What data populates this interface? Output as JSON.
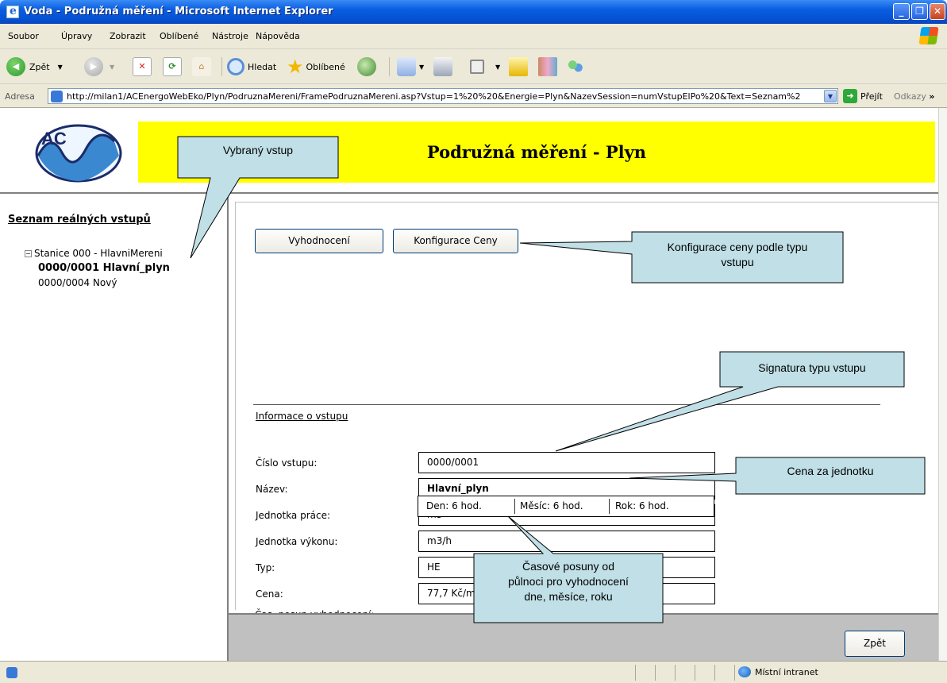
{
  "window": {
    "title": "Voda - Podružná měření - Microsoft Internet Explorer",
    "buttons": [
      "minimize-icon",
      "maximize-icon",
      "close-icon"
    ]
  },
  "menu": [
    "Soubor",
    "Úpravy",
    "Zobrazit",
    "Oblíbené",
    "Nástroje",
    "Nápověda"
  ],
  "toolbar": {
    "back": "Zpět",
    "search": "Hledat",
    "favorites": "Oblíbené"
  },
  "address": {
    "label": "Adresa",
    "url": "http://milan1/ACEnergoWebEko/Plyn/PodruznaMereni/FramePodruznaMereni.asp?Vstup=1%20%20&Energie=Plyn&NazevSession=numVstupElPo%20&Text=Seznam%2",
    "go": "Přejít",
    "links": "Odkazy"
  },
  "header": {
    "title": "Podružná měření - Plyn",
    "logo_text": "AC"
  },
  "sidebar": {
    "heading": "Seznam reálných vstupů",
    "station": "Stanice 000 - HlavniMereni",
    "items": [
      {
        "label": "0000/0001 Hlavní_plyn",
        "selected": true
      },
      {
        "label": "0000/0004 Nový",
        "selected": false
      }
    ]
  },
  "main": {
    "buttons": {
      "evaluation": "Vyhodnocení",
      "price_config": "Konfigurace Ceny"
    },
    "section_title": "Informace o vstupu",
    "fields": [
      {
        "label": "Číslo vstupu:",
        "value": "0000/0001"
      },
      {
        "label": "Název:",
        "value": "Hlavní_plyn"
      },
      {
        "label": "Jednotka práce:",
        "value": "m3"
      },
      {
        "label": "Jednotka výkonu:",
        "value": "m3/h"
      },
      {
        "label": "Typ:",
        "value": "HE"
      },
      {
        "label": "Cena:",
        "value": "77,7 Kč/m3"
      }
    ],
    "offset": {
      "label": "Čas. posun vyhodnocení:",
      "day": "Den: 6 hod.",
      "month": "Měsíc: 6 hod.",
      "year": "Rok: 6 hod."
    }
  },
  "footer": {
    "back": "Zpět"
  },
  "status": {
    "zone": "Místní intranet"
  },
  "callouts": {
    "selected_input": "Vybraný vstup",
    "price_config": [
      "Konfigurace ceny podle typu",
      "vstupu"
    ],
    "type_signature": "Signatura typu vstupu",
    "unit_price": "Cena za jednotku",
    "time_offsets": [
      "Časové posuny od",
      "půlnoci pro vyhodnocení",
      "dne, měsíce, roku"
    ]
  }
}
